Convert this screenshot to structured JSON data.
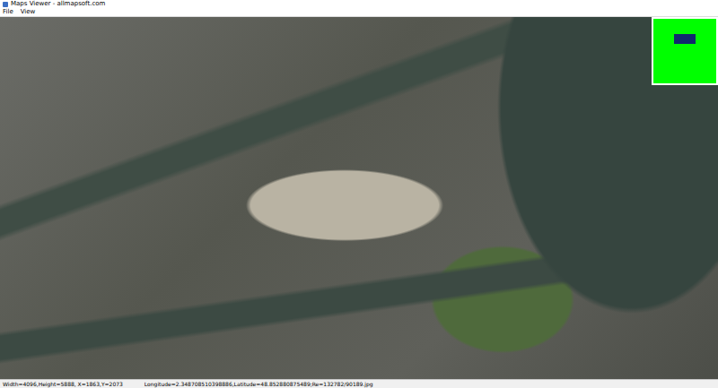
{
  "window": {
    "title": "Maps Viewer - allmapsoft.com"
  },
  "menu": [
    {
      "label": "File"
    },
    {
      "label": "View"
    }
  ],
  "status_bar": {
    "size": "Width=4096,Height=5888, X=1863,Y=2073",
    "position": "Longitude=2.348708510398886,Latitude=48.852880875489;Re=132782/90189.jpg"
  }
}
